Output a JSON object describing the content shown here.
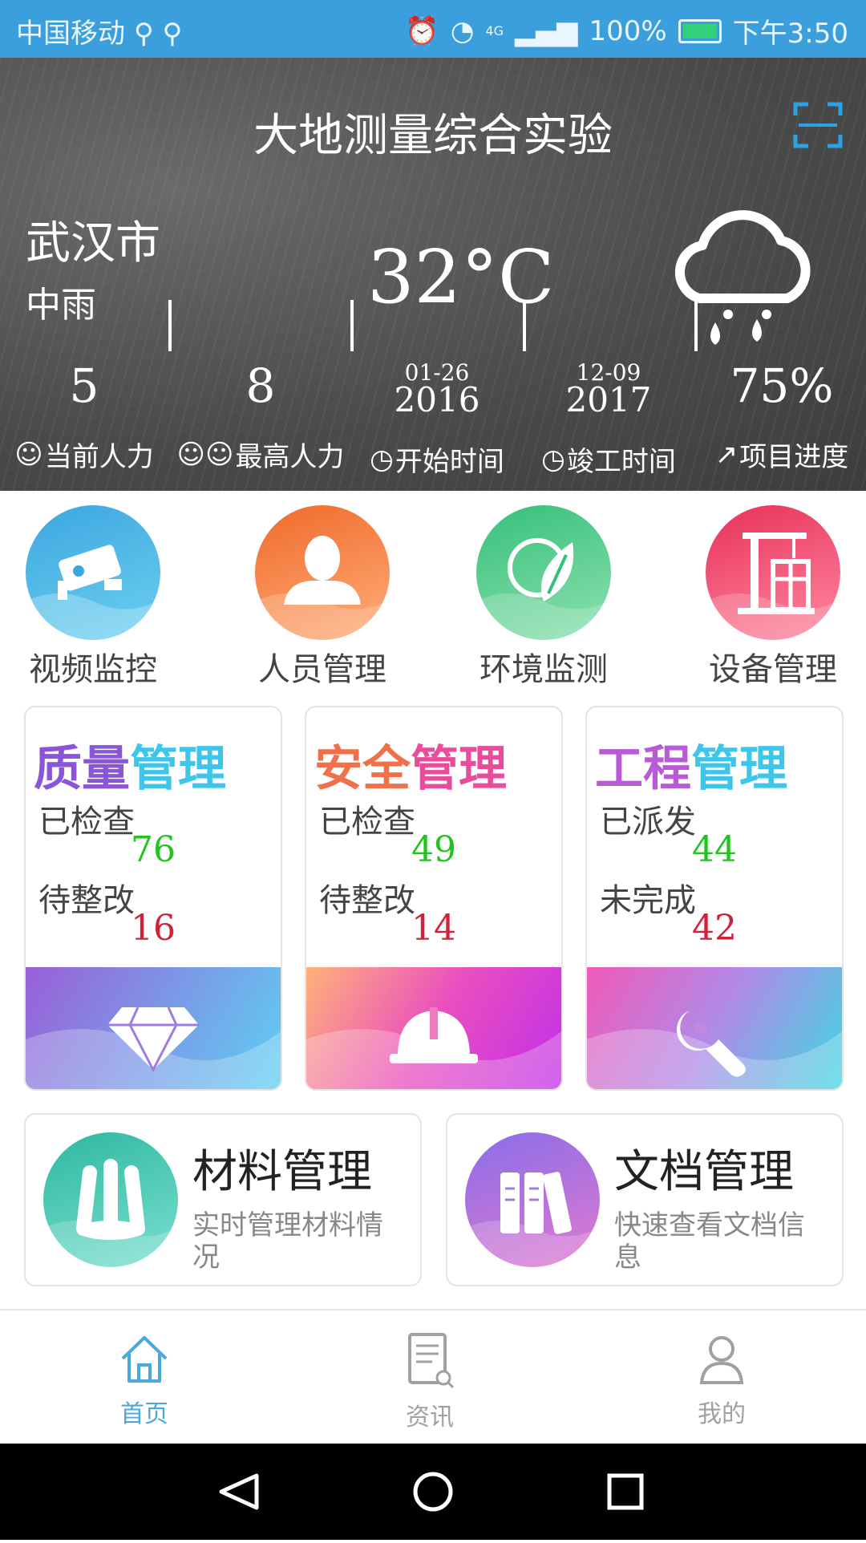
{
  "status_bar": {
    "carrier": "中国移动",
    "battery": "100%",
    "time": "下午3:50",
    "network": "4G"
  },
  "header": {
    "title": "大地测量综合实验"
  },
  "weather": {
    "city": "武汉市",
    "condition": "中雨",
    "temperature": "32°C"
  },
  "stats": [
    {
      "value": "5",
      "label": "当前人力",
      "icon": "person-icon"
    },
    {
      "value": "8",
      "label": "最高人力",
      "icon": "people-icon"
    },
    {
      "date_md": "01-26",
      "date_year": "2016",
      "label": "开始时间",
      "icon": "clock-icon"
    },
    {
      "date_md": "12-09",
      "date_year": "2017",
      "label": "竣工时间",
      "icon": "clock-icon"
    },
    {
      "value": "75%",
      "label": "项目进度",
      "icon": "trend-icon"
    }
  ],
  "modules": [
    {
      "label": "视频监控",
      "icon": "camera-icon"
    },
    {
      "label": "人员管理",
      "icon": "user-icon"
    },
    {
      "label": "环境监测",
      "icon": "leaf-globe-icon"
    },
    {
      "label": "设备管理",
      "icon": "crane-building-icon"
    }
  ],
  "cards": [
    {
      "title_a": "质量",
      "title_b": "管理",
      "label1": "已检查",
      "value1": "76",
      "label2": "待整改",
      "value2": "16",
      "icon": "diamond-icon"
    },
    {
      "title_a": "安全",
      "title_b": "管理",
      "label1": "已检查",
      "value1": "49",
      "label2": "待整改",
      "value2": "14",
      "icon": "helmet-icon"
    },
    {
      "title_a": "工程",
      "title_b": "管理",
      "label1": "已派发",
      "value1": "44",
      "label2": "未完成",
      "value2": "42",
      "icon": "wrench-icon"
    }
  ],
  "wide_cards": [
    {
      "title": "材料管理",
      "desc": "实时管理材料情况",
      "icon": "pipes-icon"
    },
    {
      "title": "文档管理",
      "desc": "快速查看文档信息",
      "icon": "books-icon"
    }
  ],
  "tabs": [
    {
      "label": "首页",
      "icon": "home-icon",
      "active": true
    },
    {
      "label": "资讯",
      "icon": "news-icon",
      "active": false
    },
    {
      "label": "我的",
      "icon": "profile-icon",
      "active": false
    }
  ],
  "colors": {
    "status_bar": "#3a9fdc",
    "active_tab": "#4aa8dd",
    "inactive_tab": "#a0a0a0",
    "checked_value": "#1fc41f",
    "pending_value": "#d0213a"
  }
}
